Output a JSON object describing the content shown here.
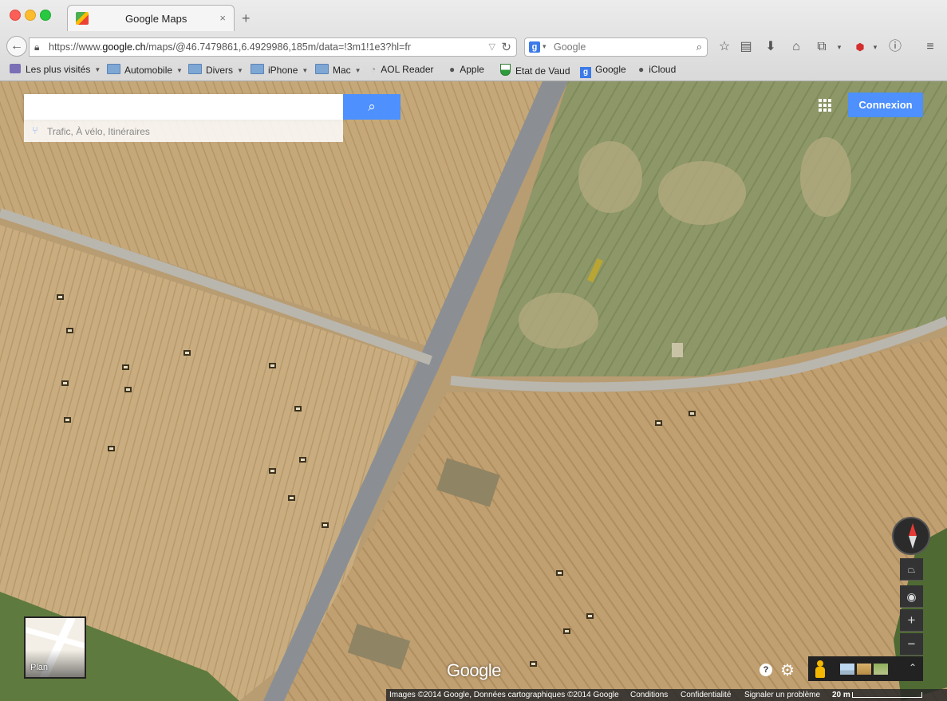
{
  "browser": {
    "tab_title": "Google Maps",
    "tab_close": "×",
    "new_tab": "+",
    "url_prefix": "https://www.",
    "url_domain": "google.ch",
    "url_path": "/maps/@46.7479861,6.4929986,185m/data=!3m1!1e3?hl=fr",
    "search_placeholder": "Google",
    "search_engine_letter": "g"
  },
  "bookmarks": [
    {
      "label": "Les plus visités",
      "icon": "most-visited-icon",
      "has_menu": true
    },
    {
      "label": "Automobile",
      "icon": "folder-icon",
      "has_menu": true
    },
    {
      "label": "Divers",
      "icon": "folder-icon",
      "has_menu": true
    },
    {
      "label": "iPhone",
      "icon": "folder-icon",
      "has_menu": true
    },
    {
      "label": "Mac",
      "icon": "folder-icon",
      "has_menu": true
    },
    {
      "label": "AOL Reader",
      "icon": "rss-icon",
      "has_menu": false
    },
    {
      "label": "Apple",
      "icon": "apple-icon",
      "has_menu": false
    },
    {
      "label": "Etat de Vaud",
      "icon": "vaud-shield-icon",
      "has_menu": false
    },
    {
      "label": "Google",
      "icon": "google-g-icon",
      "has_menu": false
    },
    {
      "label": "iCloud",
      "icon": "apple-icon",
      "has_menu": false
    }
  ],
  "maps": {
    "search_value": "",
    "directions_hint": "Trafic, À vélo, Itinéraires",
    "connexion_label": "Connexion",
    "plan_label": "Plan",
    "logo_text": "Google",
    "zoom_in": "+",
    "zoom_out": "−",
    "help": "?",
    "view_mode": "satellite"
  },
  "footer": {
    "imagery": "Images ©2014 Google, Données cartographiques ©2014 Google",
    "conditions": "Conditions",
    "privacy": "Confidentialité",
    "report": "Signaler un problème",
    "scale": "20 m"
  },
  "colors": {
    "accent_blue": "#4d90fe",
    "field_wheat": "#c2a676",
    "field_green": "#8f9a6a",
    "road": "#8b8f93"
  }
}
